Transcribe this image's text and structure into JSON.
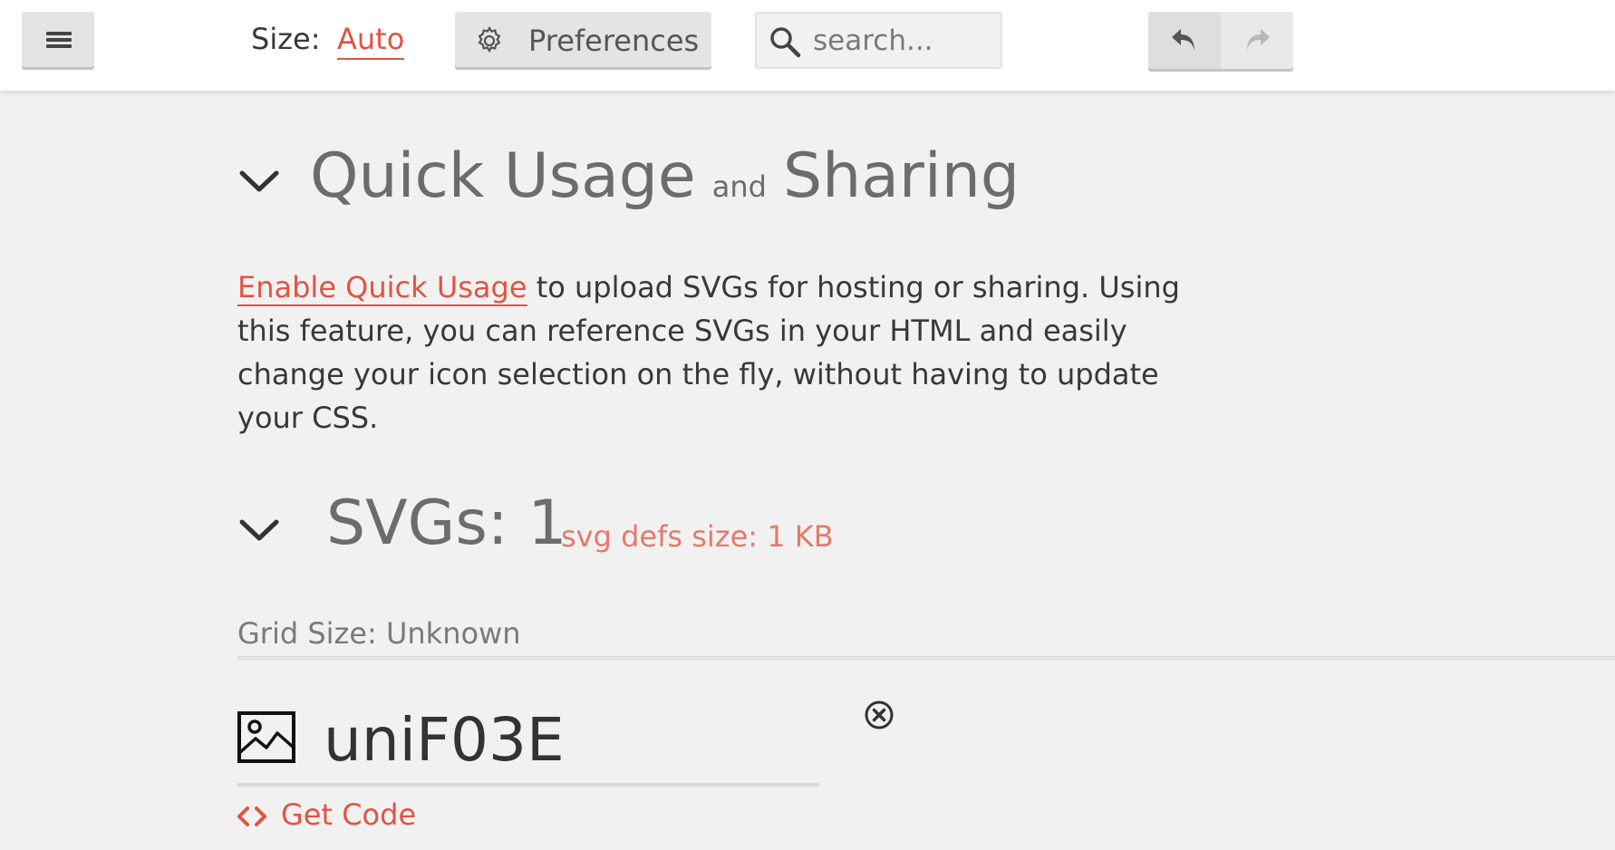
{
  "toolbar": {
    "size_label": "Size:",
    "size_value": "Auto",
    "preferences_label": "Preferences",
    "search_placeholder": "search...",
    "icons": {
      "menu": "menu-icon",
      "preferences": "gear-icon",
      "search": "search-icon",
      "undo": "undo-icon",
      "redo": "redo-icon"
    }
  },
  "quick_usage": {
    "title_part1": "Quick Usage",
    "title_joiner": "and",
    "title_part2": "Sharing",
    "link_text": "Enable Quick Usage",
    "description": " to upload SVGs for hosting or sharing. Using this feature, you can reference SVGs in your HTML and easily change your icon selection on the fly, without having to update your CSS."
  },
  "svgs": {
    "title": "SVGs: 1",
    "defs_size": "svg defs size: 1 KB",
    "grid_size": "Grid Size: Unknown",
    "items": [
      {
        "name": "uniF03E",
        "icon": "image-icon",
        "get_code_label": "Get Code"
      }
    ]
  },
  "colors": {
    "accent": "#e15443",
    "accent_light": "#e37a6d",
    "background": "#f1f1f1",
    "topbar": "#ffffff",
    "heading": "#6c6c6c",
    "button": "#e4e4e4"
  }
}
